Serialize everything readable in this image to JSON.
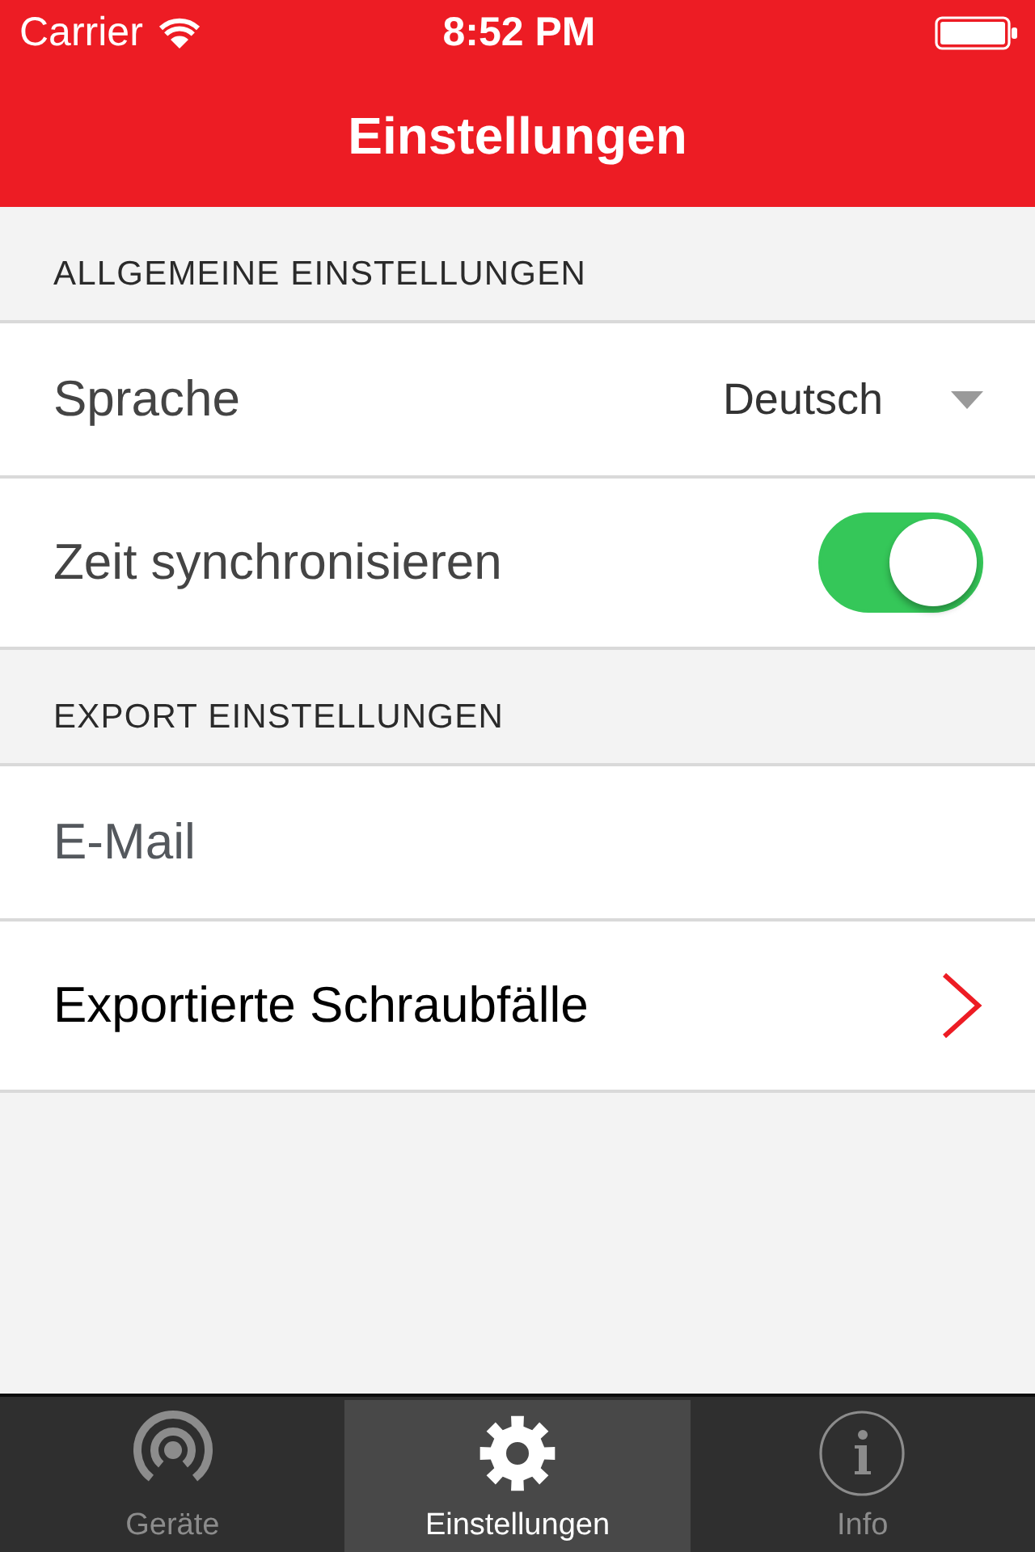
{
  "status_bar": {
    "carrier": "Carrier",
    "time": "8:52 PM"
  },
  "nav_bar": {
    "title": "Einstellungen"
  },
  "sections": [
    {
      "header": "ALLGEMEINE EINSTELLUNGEN",
      "rows": [
        {
          "kind": "dropdown",
          "label": "Sprache",
          "value": "Deutsch"
        },
        {
          "kind": "toggle",
          "label": "Zeit synchronisieren",
          "on": true
        }
      ]
    },
    {
      "header": "EXPORT EINSTELLUNGEN",
      "rows": [
        {
          "kind": "input",
          "placeholder": "E-Mail"
        },
        {
          "kind": "link",
          "label": "Exportierte Schraubfälle"
        }
      ]
    }
  ],
  "tab_bar": [
    {
      "label": "Geräte",
      "selected": false
    },
    {
      "label": "Einstellungen",
      "selected": true
    },
    {
      "label": "Info",
      "selected": false
    }
  ]
}
